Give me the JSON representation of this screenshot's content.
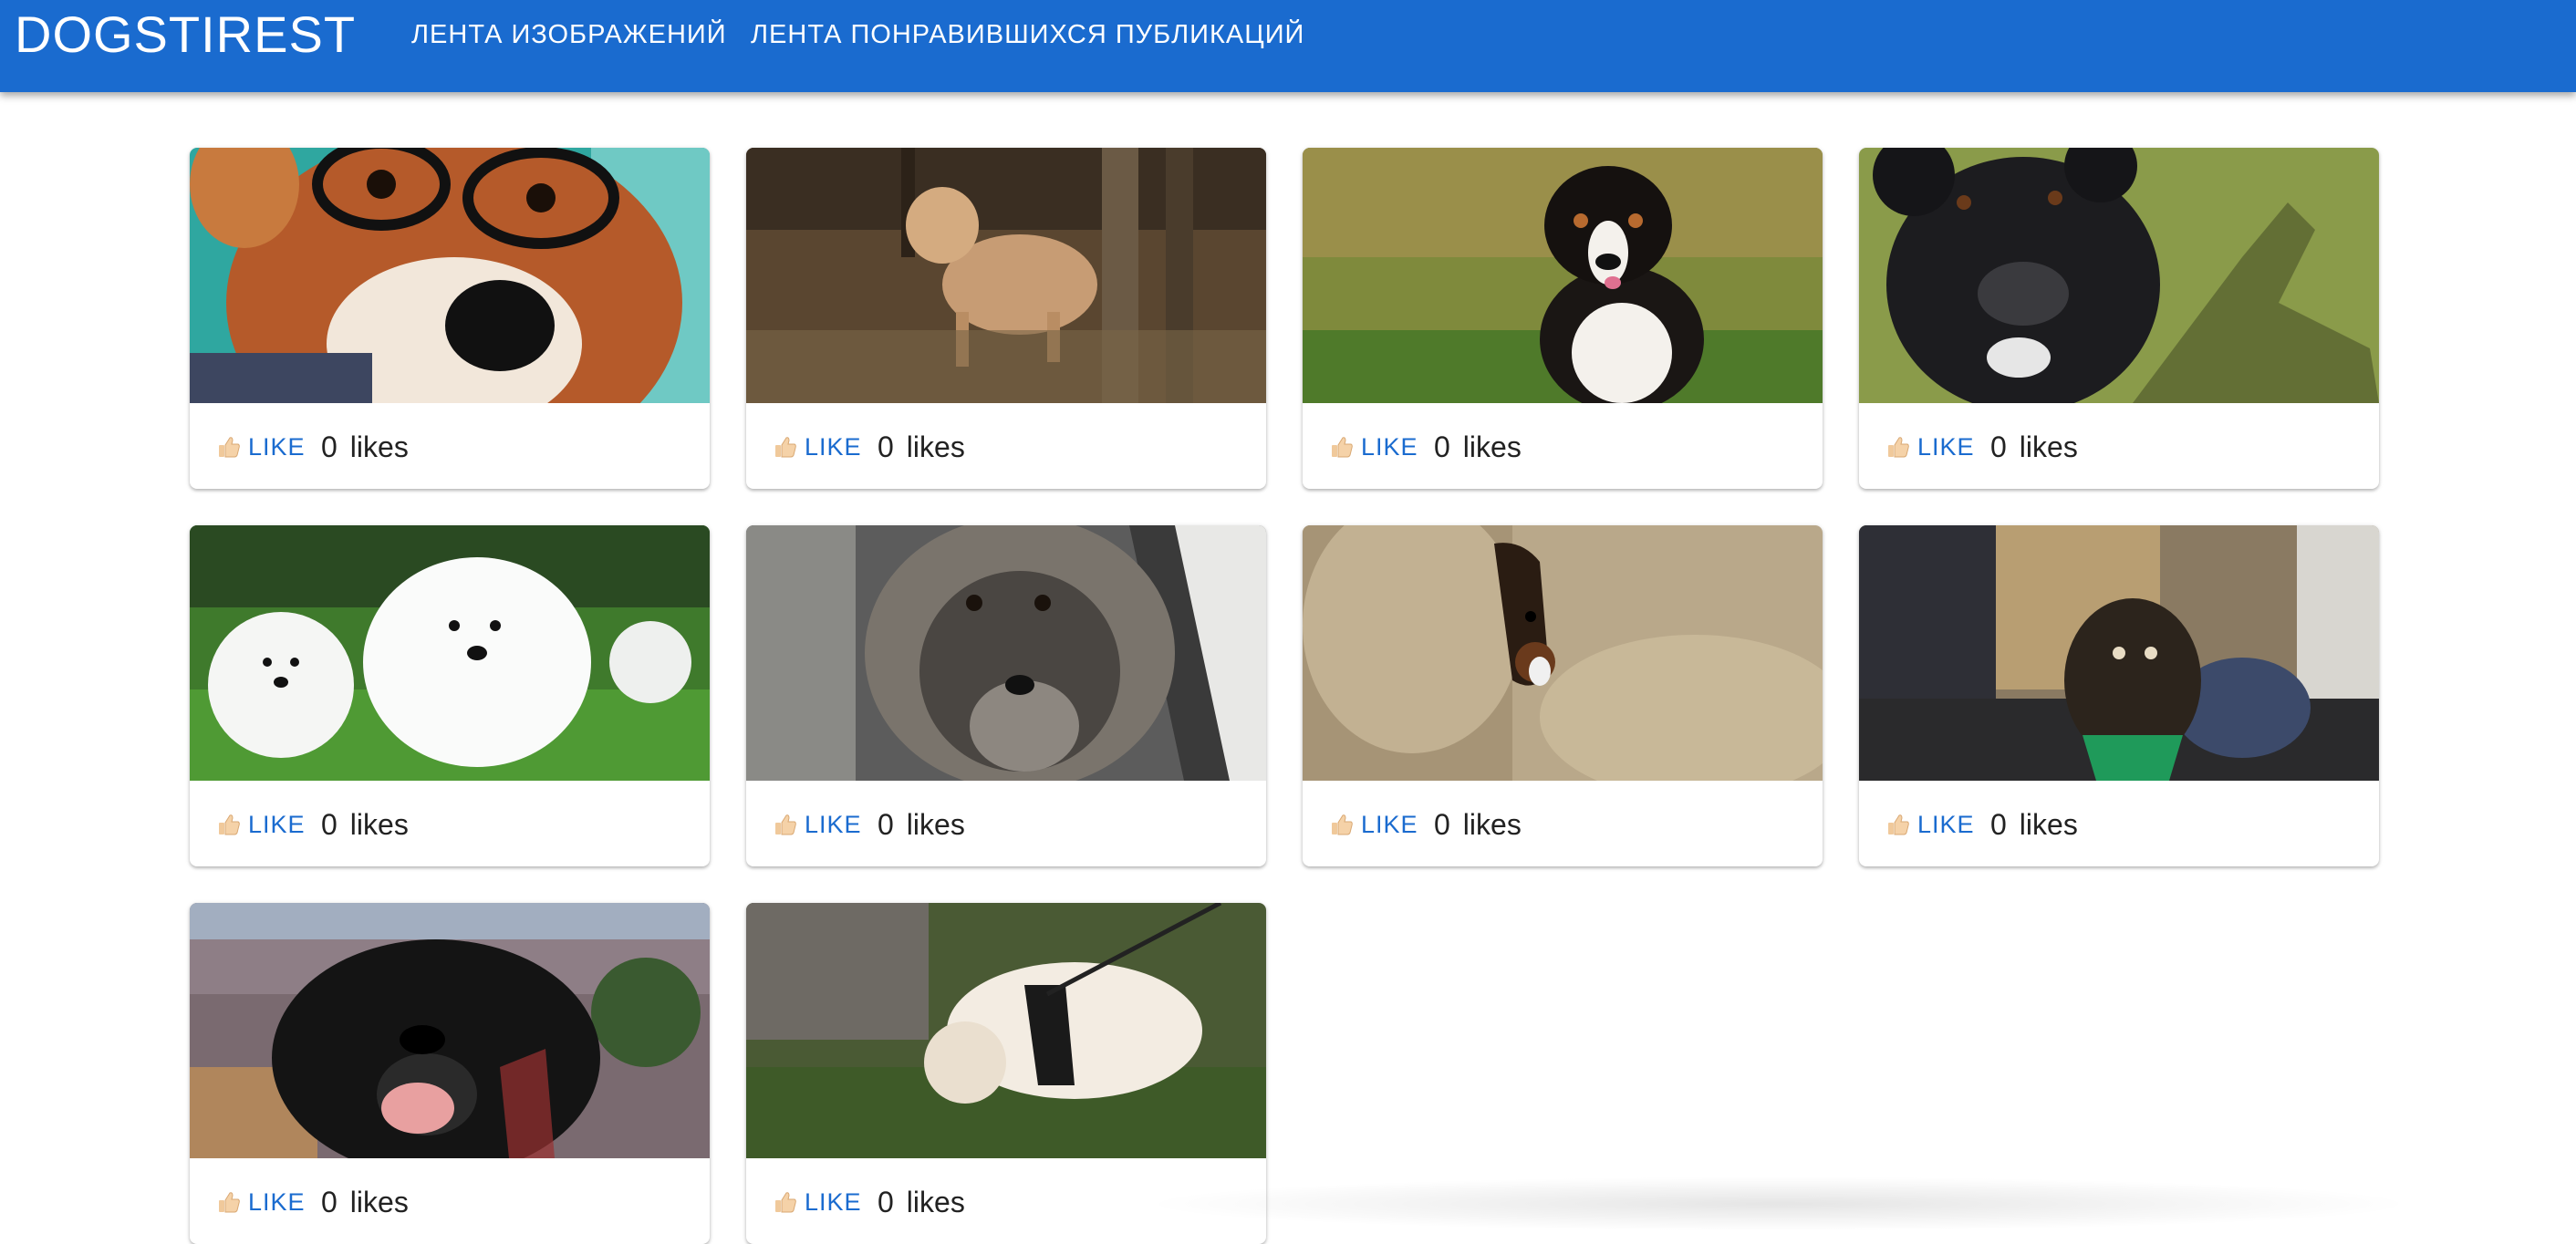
{
  "header": {
    "brand": "DOGSTIREST",
    "nav": [
      "ЛЕНТА ИЗОБРАЖЕНИЙ",
      "ЛЕНТА ПОНРАВИВШИХСЯ ПУБЛИКАЦИЙ"
    ]
  },
  "colors": {
    "appbar": "#1a6bcf",
    "accent": "#1a6bcf"
  },
  "cards": [
    {
      "subject": "corgi-with-glasses",
      "like_label": "LIKE",
      "count": "0",
      "count_unit": "likes"
    },
    {
      "subject": "curly-poodle-in-forest",
      "like_label": "LIKE",
      "count": "0",
      "count_unit": "likes"
    },
    {
      "subject": "bernese-puppy",
      "like_label": "LIKE",
      "count": "0",
      "count_unit": "likes"
    },
    {
      "subject": "black-dog-on-grass",
      "like_label": "LIKE",
      "count": "0",
      "count_unit": "likes"
    },
    {
      "subject": "samoyed-puppies",
      "like_label": "LIKE",
      "count": "0",
      "count_unit": "likes"
    },
    {
      "subject": "grey-elkhound",
      "like_label": "LIKE",
      "count": "0",
      "count_unit": "likes"
    },
    {
      "subject": "dog-in-sofa",
      "like_label": "LIKE",
      "count": "0",
      "count_unit": "likes"
    },
    {
      "subject": "spaniel-in-room",
      "like_label": "LIKE",
      "count": "0",
      "count_unit": "likes"
    },
    {
      "subject": "black-lab-canyon",
      "like_label": "LIKE",
      "count": "0",
      "count_unit": "likes"
    },
    {
      "subject": "white-fluffy-dog-on-leash",
      "like_label": "LIKE",
      "count": "0",
      "count_unit": "likes"
    }
  ],
  "icons": {
    "like": "thumbs-up-icon"
  }
}
